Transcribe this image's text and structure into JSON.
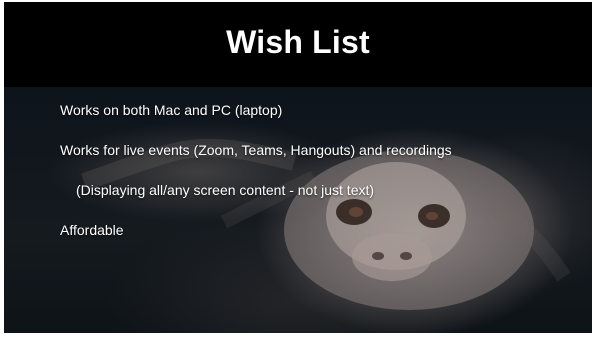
{
  "slide": {
    "title": "Wish List",
    "background_image": "luckdragon-falkor-still",
    "bullets": [
      {
        "text": "Works on both Mac and PC (laptop)",
        "indent": false
      },
      {
        "text": "Works for live events (Zoom, Teams, Hangouts) and recordings",
        "indent": false
      },
      {
        "text": "(Displaying all/any screen content - not just text)",
        "indent": true
      },
      {
        "text": "Affordable",
        "indent": false
      }
    ]
  },
  "colors": {
    "title_band": "#000000",
    "text": "#ffffff",
    "page_bg": "#ffffff"
  }
}
